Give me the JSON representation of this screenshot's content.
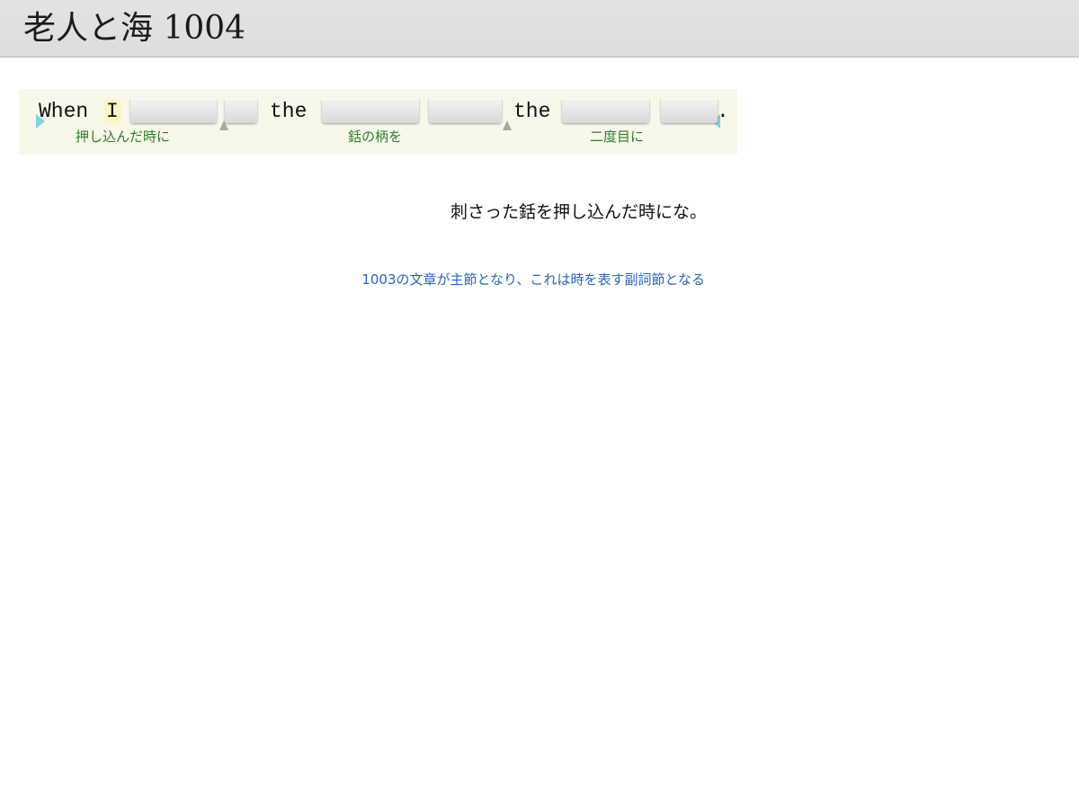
{
  "header": {
    "title": "老人と海 1004"
  },
  "sentence": {
    "words": [
      "When",
      "I",
      "the",
      "the",
      "."
    ],
    "blanks_count_label": "",
    "glosses": [
      "押し込んだ時に",
      "銛の柄を",
      "二度目に"
    ]
  },
  "translation": "刺さった銛を押し込んだ時にな。",
  "hint": "1003の文章が主節となり、これは時を表す副詞節となる",
  "colors": {
    "header_bg": "#dcdddf",
    "panel_bg": "#f7f7ea",
    "gloss": "#2d7d2d",
    "hint": "#2a63b8",
    "highlight": "#fbf6c6",
    "arrow": "#7fd4e0"
  },
  "icons": {
    "left_arrow": "triangle-right-icon",
    "right_arrow": "triangle-left-icon"
  }
}
